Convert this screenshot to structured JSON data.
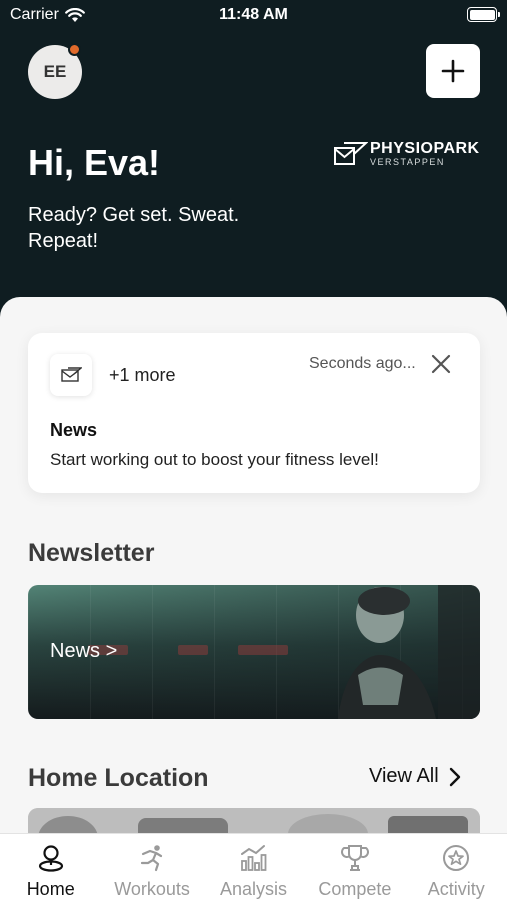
{
  "status_bar": {
    "carrier": "Carrier",
    "time": "11:48 AM",
    "battery_level": 1.0
  },
  "header": {
    "avatar_initials": "EE",
    "has_notification_dot": true,
    "greeting": "Hi, Eva!",
    "tagline": "Ready? Get set. Sweat. Repeat!",
    "brand_name": "PHYSIOPARK",
    "brand_sub": "VERSTAPPEN",
    "add_icon": "plus-icon"
  },
  "notification": {
    "icon": "envelope-icon",
    "more_label": "+1 more",
    "time": "Seconds ago...",
    "title": "News",
    "body": "Start working out to boost your fitness level!",
    "close_icon": "close-icon"
  },
  "newsletter": {
    "title": "Newsletter",
    "banner_label": "News >"
  },
  "home_location": {
    "title": "Home Location",
    "view_all": "View All"
  },
  "tabs": [
    {
      "label": "Home",
      "icon": "home-location-icon",
      "active": true
    },
    {
      "label": "Workouts",
      "icon": "runner-icon",
      "active": false
    },
    {
      "label": "Analysis",
      "icon": "chart-icon",
      "active": false
    },
    {
      "label": "Compete",
      "icon": "trophy-icon",
      "active": false
    },
    {
      "label": "Activity",
      "icon": "star-badge-icon",
      "active": false
    }
  ],
  "colors": {
    "header_bg": "#0f1d21",
    "panel_bg": "#f6f6f6",
    "notification_dot": "#e06a2b",
    "tab_active": "#111111",
    "tab_inactive": "#9a9a9a"
  }
}
